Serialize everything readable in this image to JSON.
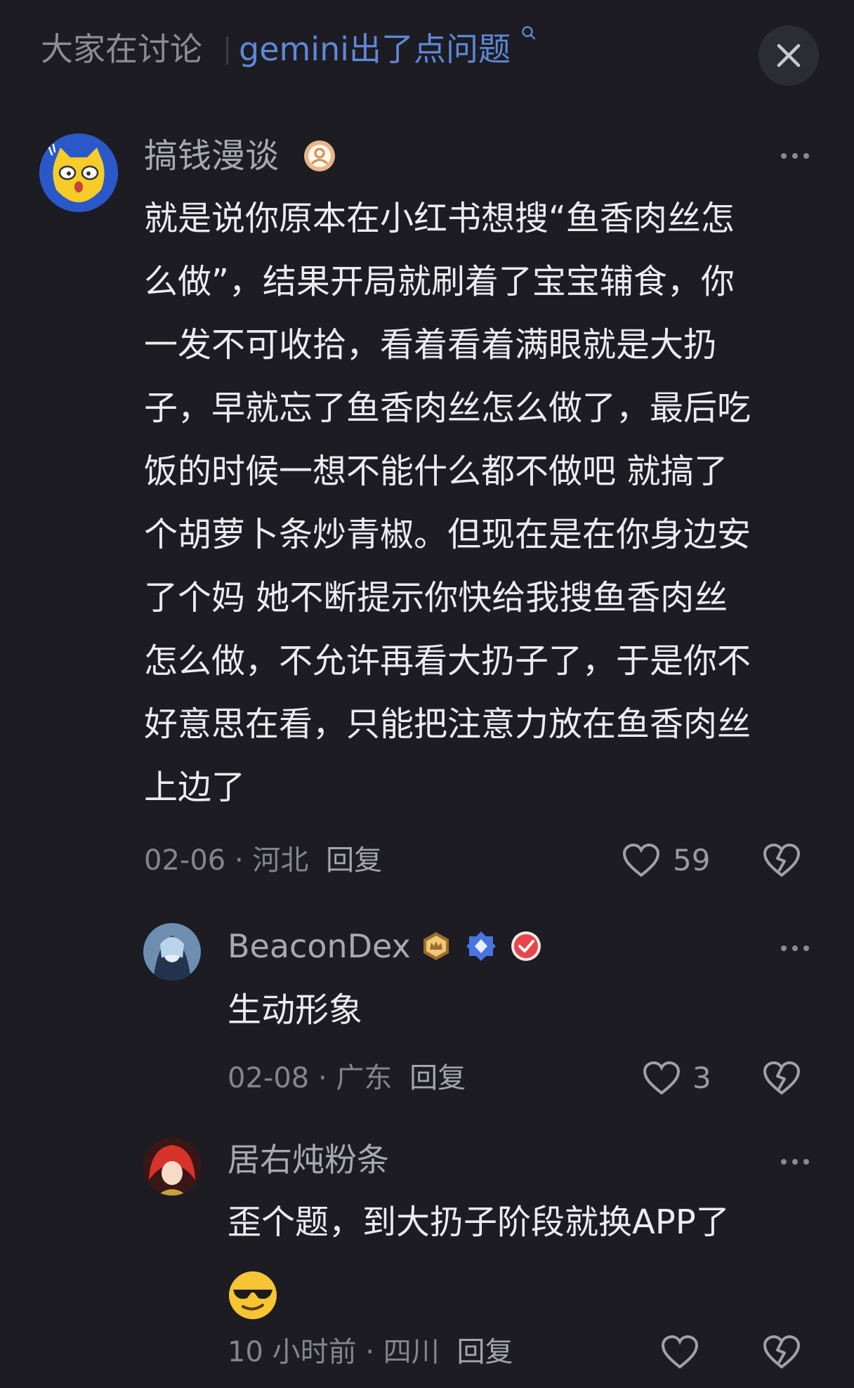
{
  "header": {
    "title": "大家在讨论",
    "query": "gemini出了点问题"
  },
  "comments": [
    {
      "username": "搞钱漫谈",
      "text_lines": [
        "就是说你原本在小红书想搜“鱼香肉丝怎",
        "么做”，结果开局就刷着了宝宝辅食，你",
        "一发不可收拾，看着看着满眼就是大扔",
        "子，早就忘了鱼香肉丝怎么做了，最后吃",
        "饭的时候一想不能什么都不做吧 就搞了",
        "个胡萝卜条炒青椒。但现在是在你身边安",
        "了个妈 她不断提示你快给我搜鱼香肉丝",
        "怎么做，不允许再看大扔子了，于是你不",
        "好意思在看，只能把注意力放在鱼香肉丝",
        "上边了"
      ],
      "date": "02-06",
      "location": "河北",
      "reply_label": "回复",
      "likes": "59"
    },
    {
      "username": "BeaconDex",
      "text_lines": [
        "生动形象"
      ],
      "date": "02-08",
      "location": "广东",
      "reply_label": "回复",
      "likes": "3"
    },
    {
      "username": "居右炖粉条",
      "text_lines": [
        "歪个题，到大扔子阶段就换APP了"
      ],
      "emoji": "😎",
      "date": "10 小时前",
      "location": "四川",
      "reply_label": "回复",
      "likes": ""
    }
  ],
  "colors": {
    "background": "#1c1c22",
    "accent": "#5f87d8",
    "muted": "#85858d"
  }
}
